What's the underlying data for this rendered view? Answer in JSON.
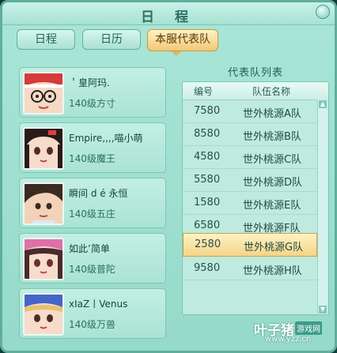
{
  "window": {
    "title": "日 程"
  },
  "tabs": [
    {
      "label": "日程",
      "active": false
    },
    {
      "label": "日历",
      "active": false
    },
    {
      "label": "本服代表队",
      "active": true
    }
  ],
  "players": [
    {
      "name": "＇皇阿玛.",
      "level": "140级方寸",
      "avatar": "avatar-red-hat-glasses"
    },
    {
      "name": "Empire,,,,喵小萌",
      "level": "140级魔王",
      "avatar": "avatar-dark-hair-girl"
    },
    {
      "name": "瞬间 d é 永恒",
      "level": "140级五庄",
      "avatar": "avatar-brown-hair-boy"
    },
    {
      "name": "如此’简单",
      "level": "140级普陀",
      "avatar": "avatar-pink-hat-girl"
    },
    {
      "name": "xIaZ丨Venus",
      "level": "140级万兽",
      "avatar": "avatar-blue-hat-kid"
    }
  ],
  "team_list": {
    "title": "代表队列表",
    "headers": {
      "num": "编号",
      "name": "队伍名称"
    },
    "rows": [
      {
        "num": "7580",
        "name": "世外桃源A队",
        "selected": false
      },
      {
        "num": "8580",
        "name": "世外桃源B队",
        "selected": false
      },
      {
        "num": "4580",
        "name": "世外桃源C队",
        "selected": false
      },
      {
        "num": "5580",
        "name": "世外桃源D队",
        "selected": false
      },
      {
        "num": "1580",
        "name": "世外桃源E队",
        "selected": false
      },
      {
        "num": "6580",
        "name": "世外桃源F队",
        "selected": false
      },
      {
        "num": "2580",
        "name": "世外桃源G队",
        "selected": true
      },
      {
        "num": "9580",
        "name": "世外桃源H队",
        "selected": false
      }
    ]
  },
  "watermark": {
    "main": "叶子猪",
    "tag": "游戏网",
    "url": "www.yzz.cn"
  }
}
